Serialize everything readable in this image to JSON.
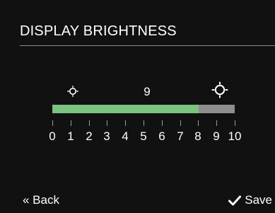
{
  "screen": {
    "title": "DISPLAY BRIGHTNESS"
  },
  "slider": {
    "value": 9,
    "value_text": "9",
    "min": 0,
    "max": 10,
    "fill_color": "#7bc47f",
    "track_color": "#8e8e8e",
    "dim_icon": "sun-small-icon",
    "bright_icon": "sun-large-icon",
    "scale_labels": [
      "0",
      "1",
      "2",
      "3",
      "4",
      "5",
      "6",
      "7",
      "8",
      "9",
      "10"
    ]
  },
  "footer": {
    "back_label": "« Back",
    "save_label": "Save",
    "save_icon": "checkmark-icon"
  }
}
